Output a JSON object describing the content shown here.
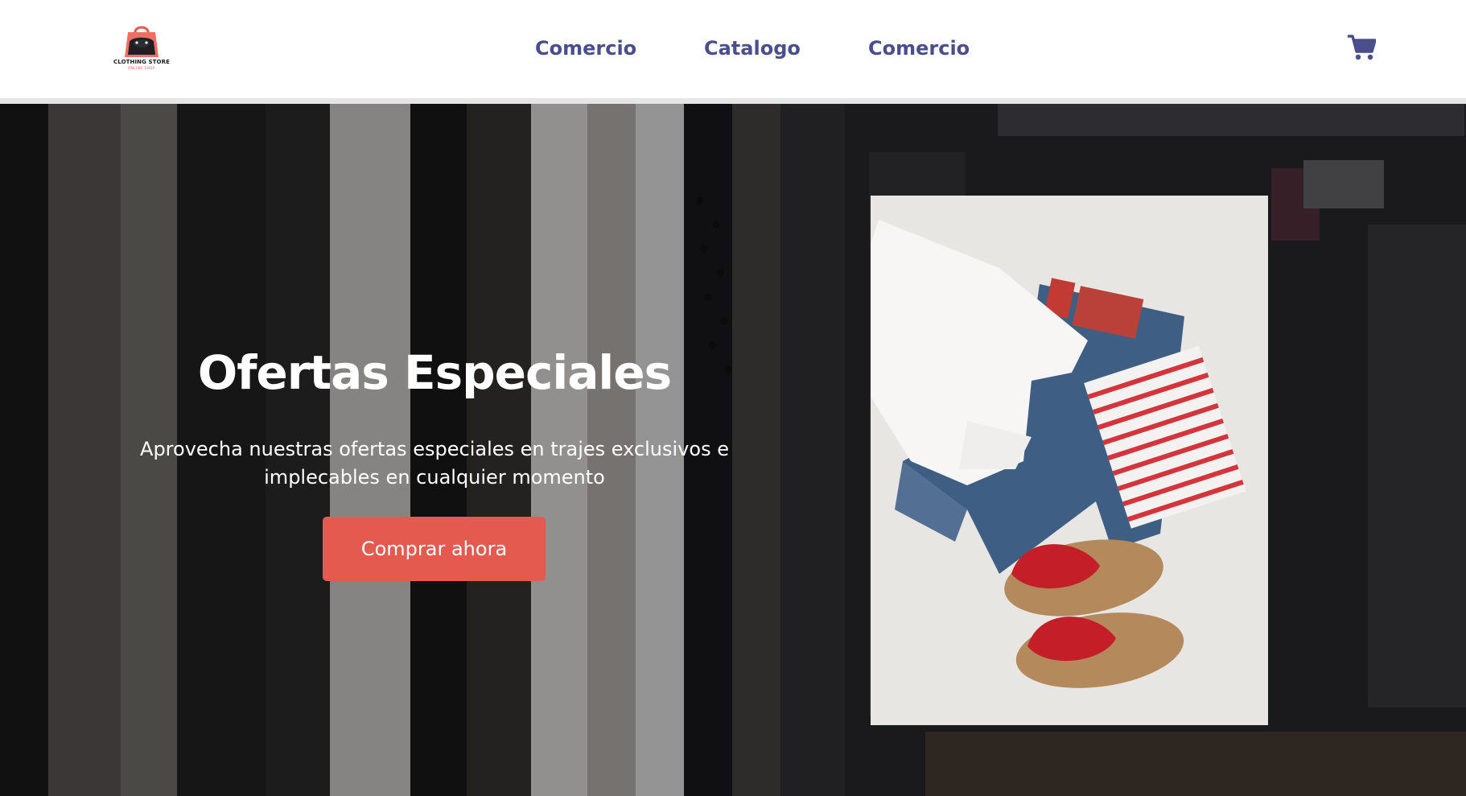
{
  "header": {
    "logo": {
      "icon": "shopping-bag-logo-icon",
      "brand_text": "CLOTHING STORE",
      "sub_text": "ONLINE SHOP"
    },
    "nav": {
      "items": [
        {
          "label": "Comercio"
        },
        {
          "label": "Catalogo"
        },
        {
          "label": "Comercio"
        }
      ]
    },
    "cart": {
      "icon": "shopping-cart-icon"
    }
  },
  "hero": {
    "title": "Ofertas Especiales",
    "subtitle": "Aprovecha nuestras ofertas especiales en trajes exclusivos e implecables en cualquier momento",
    "button_label": "Comprar ahora",
    "background": "clothing-rack-photo",
    "product_image": "flatlay-shirt-jeans-sandals-photo"
  },
  "colors": {
    "accent": "#e55a4e",
    "nav_text": "#4a4e8a",
    "header_bg": "#ffffff",
    "hero_text": "#ffffff"
  }
}
